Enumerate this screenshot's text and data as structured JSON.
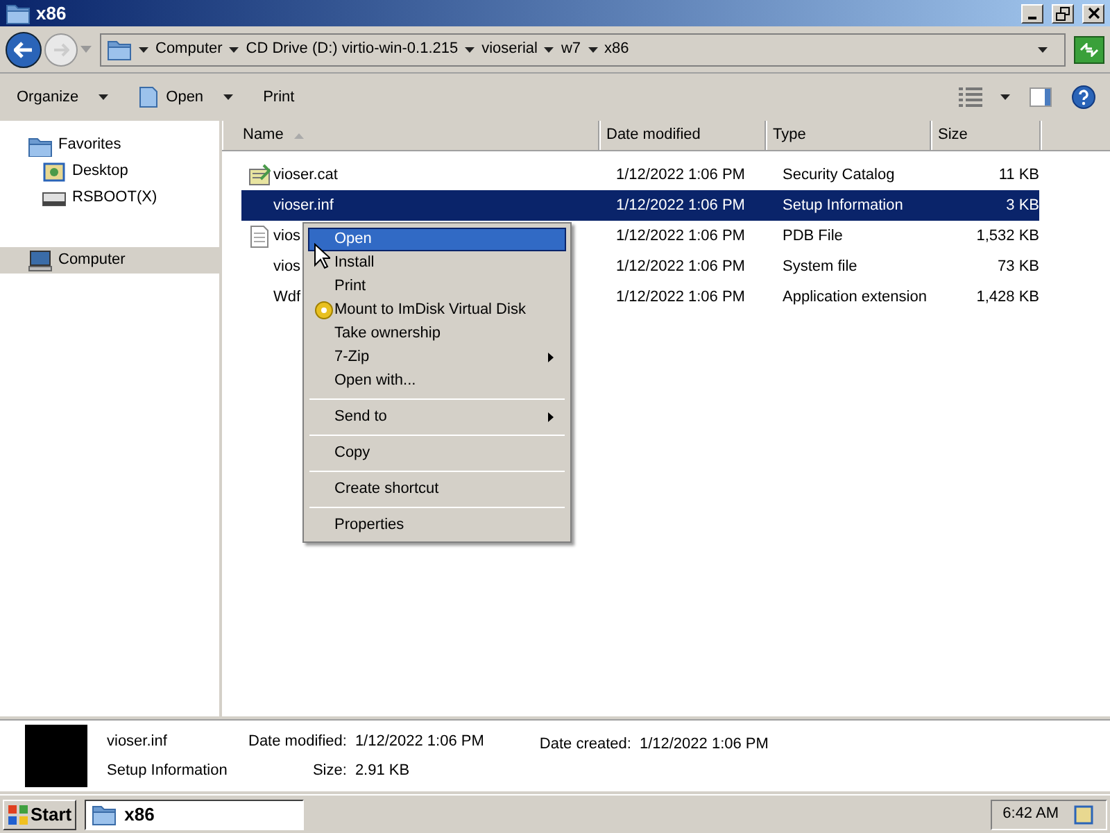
{
  "window": {
    "title": "x86"
  },
  "address": {
    "crumbs": [
      "Computer",
      "CD Drive (D:) virtio-win-0.1.215",
      "vioserial",
      "w7",
      "x86"
    ]
  },
  "toolbar": {
    "items": [
      {
        "label": "Organize",
        "kind": "dropdown"
      },
      {
        "label": "Open",
        "kind": "dropdown"
      },
      {
        "label": "Print",
        "kind": "plain"
      }
    ]
  },
  "sidebar": {
    "items": [
      {
        "label": "Favorites",
        "selected": false,
        "children": [
          {
            "label": "Desktop",
            "selected": false
          },
          {
            "label": "RSBOOT(X)",
            "selected": false
          }
        ]
      },
      {
        "label": "Computer",
        "selected": true
      }
    ]
  },
  "table": {
    "columns": [
      "Name",
      "Date modified",
      "Type",
      "Size"
    ],
    "rows": [
      {
        "name": "vioser.cat",
        "kind": "catalog",
        "date": "1/12/2022 1:06 PM",
        "type": "Security Catalog",
        "size": "11 KB",
        "selected": false
      },
      {
        "name": "vioser.inf",
        "date": "1/12/2022 1:06 PM",
        "type": "Setup Information",
        "size": "3 KB",
        "selected": true
      },
      {
        "name": "vios",
        "kind": "document",
        "date": "1/12/2022 1:06 PM",
        "type": "PDB File",
        "size": "1,532 KB",
        "selected": false
      },
      {
        "name": "vios",
        "date": "1/12/2022 1:06 PM",
        "type": "System file",
        "size": "73 KB",
        "selected": false
      },
      {
        "name": "Wdf",
        "date": "1/12/2022 1:06 PM",
        "type": "Application extension",
        "size": "1,428 KB",
        "selected": false
      }
    ]
  },
  "context_menu": {
    "items": [
      {
        "kind": "item",
        "label": "Open",
        "selected": true
      },
      {
        "kind": "item",
        "label": "Install",
        "selected": false
      },
      {
        "kind": "item",
        "label": "Print",
        "selected": false
      },
      {
        "kind": "disc_item",
        "label": "Mount to ImDisk Virtual Disk",
        "selected": false
      },
      {
        "kind": "item",
        "label": "Take ownership",
        "selected": false
      },
      {
        "kind": "item",
        "label": "7-Zip",
        "selected": false,
        "submenu": true
      },
      {
        "kind": "item",
        "label": "Open with...",
        "selected": false
      },
      {
        "kind": "separator"
      },
      {
        "kind": "item",
        "label": "Send to",
        "selected": false,
        "submenu": true
      },
      {
        "kind": "separator"
      },
      {
        "kind": "item",
        "label": "Copy",
        "selected": false
      },
      {
        "kind": "separator"
      },
      {
        "kind": "item",
        "label": "Create shortcut",
        "selected": false
      },
      {
        "kind": "separator"
      },
      {
        "kind": "item",
        "label": "Properties",
        "selected": false
      }
    ]
  },
  "details": {
    "name": "vioser.inf",
    "type": "Setup Information",
    "fields": [
      {
        "label": "Date modified:",
        "value": "1/12/2022 1:06 PM"
      },
      {
        "label": "Size:",
        "value": "2.91 KB"
      },
      {
        "label": "Date created:",
        "value": "1/12/2022 1:06 PM"
      }
    ]
  },
  "taskbar": {
    "start": "Start",
    "tasks": [
      {
        "label": "x86",
        "selected": true
      }
    ],
    "clock": "6:42 AM"
  }
}
